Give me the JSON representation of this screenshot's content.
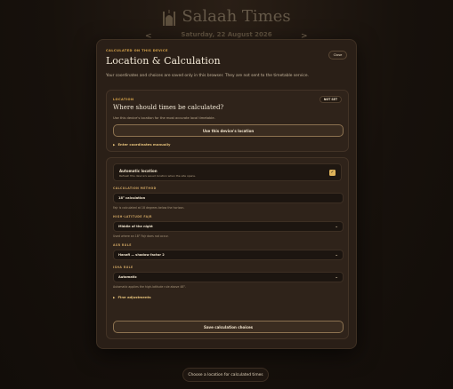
{
  "app": {
    "title": "Salaah Times",
    "date": "Saturday, 22 August 2026",
    "prev_arrow": "<",
    "next_arrow": ">"
  },
  "modal": {
    "eyebrow": "CALCULATED ON THIS DEVICE",
    "title": "Location & Calculation",
    "close_label": "Close",
    "intro": "Your coordinates and choices are saved only in this browser. They are not sent to the timetable service."
  },
  "location": {
    "section_label": "LOCATION",
    "status_pill": "NOT SET",
    "title": "Where should times be calculated?",
    "subtitle": "Use this device's location for the most accurate local timetable.",
    "use_device_button": "Use this device's location",
    "manual_toggle": "Enter coordinates manually"
  },
  "calculation": {
    "auto": {
      "title": "Automatic location",
      "subtitle": "Refresh this device's saved location when the site opens.",
      "checked": true
    },
    "method": {
      "label": "CALCULATION METHOD",
      "value": "18° calculation",
      "hint": "Fajr is calculated at 18 degrees below the horizon."
    },
    "high_latitude": {
      "label": "HIGH-LATITUDE FAJR",
      "value": "Middle of the night",
      "hint": "Used where an 18° Fajr does not occur."
    },
    "asr": {
      "label": "ASR RULE",
      "value": "Hanafi — shadow factor 2"
    },
    "isha": {
      "label": "ISHA RULE",
      "value": "Automatic",
      "hint": "Automatic applies the high-latitude rule above 48°."
    },
    "fine_toggle": "Fine adjustments",
    "save_button": "Save calculation choices"
  },
  "footer": {
    "choose_button": "Choose a location for calculated times"
  },
  "colors": {
    "accent": "#d9a54a",
    "background": "#17110c",
    "panel": "#2a1f17"
  }
}
